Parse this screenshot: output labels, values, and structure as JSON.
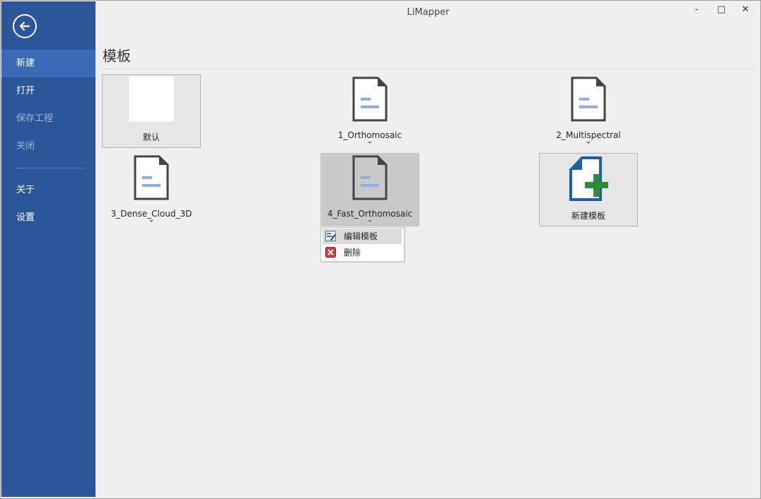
{
  "window": {
    "title": "LiMapper",
    "minimize_label": "-",
    "maximize_label": "□",
    "close_label": "✕"
  },
  "sidebar": {
    "back_icon": "back-arrow-icon",
    "items": [
      {
        "label": "新建",
        "state": "active"
      },
      {
        "label": "打开",
        "state": "normal"
      },
      {
        "label": "保存工程",
        "state": "disabled"
      },
      {
        "label": "关闭",
        "state": "disabled"
      },
      {
        "label": "关于",
        "state": "normal"
      },
      {
        "label": "设置",
        "state": "normal"
      }
    ]
  },
  "main": {
    "section_title": "模板",
    "templates": [
      {
        "label": "默认",
        "kind": "blank"
      },
      {
        "label": "1_Orthomosaic",
        "kind": "document"
      },
      {
        "label": "2_Multispectral",
        "kind": "document"
      },
      {
        "label": "3_Dense_Cloud_3D",
        "kind": "document"
      },
      {
        "label": "4_Fast_Orthomosaic",
        "kind": "document",
        "selected": true
      },
      {
        "label": "新建模板",
        "kind": "new"
      }
    ]
  },
  "context_menu": {
    "items": [
      {
        "label": "编辑模板",
        "icon": "edit-template-icon"
      },
      {
        "label": "删除",
        "icon": "delete-icon"
      }
    ]
  },
  "colors": {
    "sidebar": "#2b579a",
    "sidebar_active": "#3a6bb8",
    "doc_lines": "#8eaee6",
    "new_icon_blue": "#1f5fa8",
    "new_icon_green": "#2e8b3a",
    "delete_red": "#d83b3b"
  }
}
